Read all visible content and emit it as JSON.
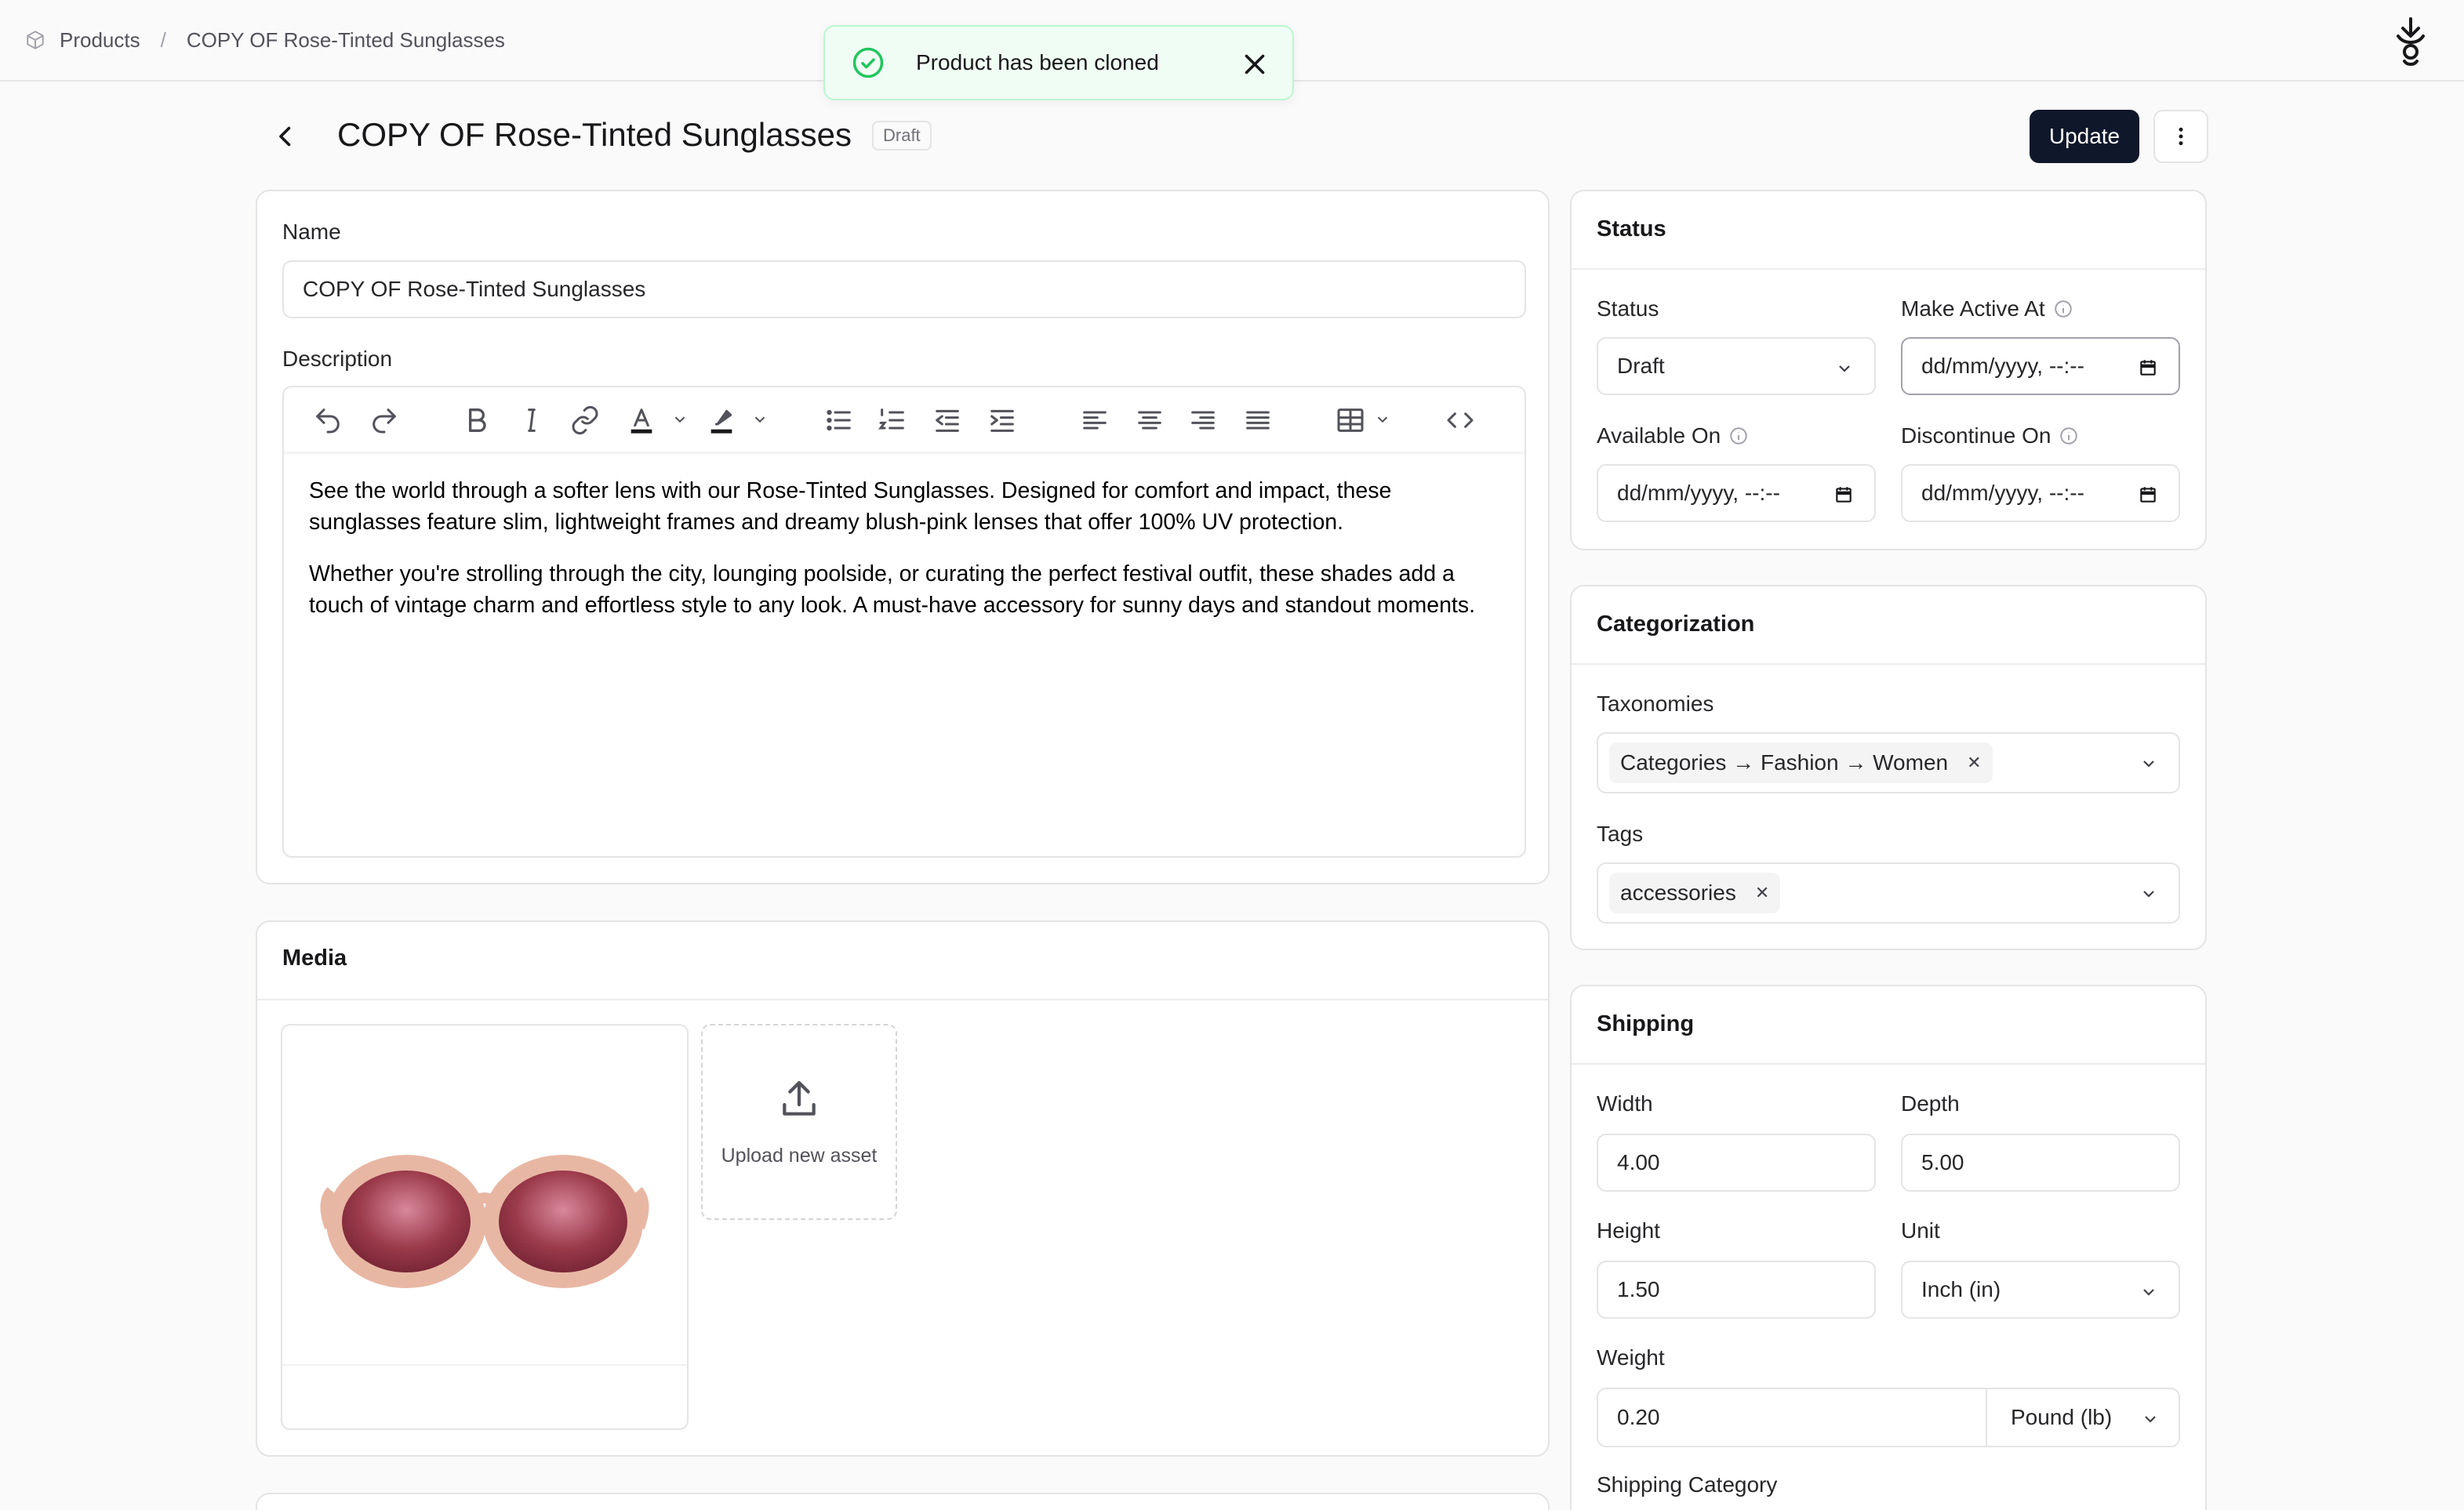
{
  "breadcrumb": {
    "root": "Products",
    "current": "COPY OF Rose-Tinted Sunglasses"
  },
  "toast": {
    "message": "Product has been cloned"
  },
  "header": {
    "title": "COPY OF Rose-Tinted Sunglasses",
    "badge": "Draft",
    "update_label": "Update"
  },
  "general": {
    "name_label": "Name",
    "name_value": "COPY OF Rose-Tinted Sunglasses",
    "description_label": "Description",
    "description_paragraphs": [
      "See the world through a softer lens with our Rose-Tinted Sunglasses. Designed for comfort and impact, these sunglasses feature slim, lightweight frames and dreamy blush-pink lenses that offer 100% UV protection.",
      "Whether you're strolling through the city, lounging poolside, or curating the perfect festival outfit, these shades add a touch of vintage charm and effortless style to any look. A must-have accessory for sunny days and standout moments."
    ]
  },
  "media": {
    "title": "Media",
    "upload_label": "Upload new asset"
  },
  "status": {
    "title": "Status",
    "status_label": "Status",
    "status_value": "Draft",
    "make_active_label": "Make Active At",
    "available_label": "Available On",
    "discontinue_label": "Discontinue On",
    "datetime_placeholder": "dd/mm/yyyy, --:--"
  },
  "categorization": {
    "title": "Categorization",
    "taxonomies_label": "Taxonomies",
    "taxonomy_chip": "Categories → Fashion → Women",
    "tags_label": "Tags",
    "tag_chip": "accessories"
  },
  "shipping": {
    "title": "Shipping",
    "width_label": "Width",
    "width_value": "4.00",
    "depth_label": "Depth",
    "depth_value": "5.00",
    "height_label": "Height",
    "height_value": "1.50",
    "unit_label": "Unit",
    "unit_value": "Inch (in)",
    "weight_label": "Weight",
    "weight_value": "0.20",
    "weight_unit": "Pound (lb)",
    "category_label": "Shipping Category"
  },
  "colors": {
    "primary": "#0f172a",
    "success": "#22c55e",
    "border": "#e4e4e7",
    "lens": "#8b2f3c",
    "frame": "#e8b7a4"
  }
}
